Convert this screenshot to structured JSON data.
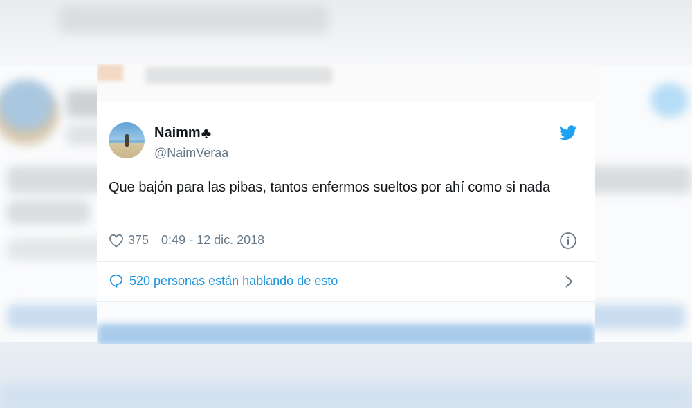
{
  "tweet": {
    "display_name": "Naimm",
    "name_emoji": "♣",
    "handle": "@NaimVeraa",
    "text": "Que bajón para las pibas, tantos enfermos sueltos por ahí como si nada",
    "likes": "375",
    "timestamp": "0:49 - 12 dic. 2018",
    "conversation_link": "520 personas están hablando de esto"
  },
  "icons": {
    "brand": "twitter-bird-icon",
    "like": "heart-icon",
    "info": "info-icon",
    "reply": "speech-bubble-icon",
    "navigate": "chevron-right-icon"
  },
  "colors": {
    "twitter_blue": "#1da1f2",
    "link_blue": "#1b95e0",
    "text_primary": "#14171a",
    "text_secondary": "#657786",
    "divider": "#e6ecf0"
  }
}
